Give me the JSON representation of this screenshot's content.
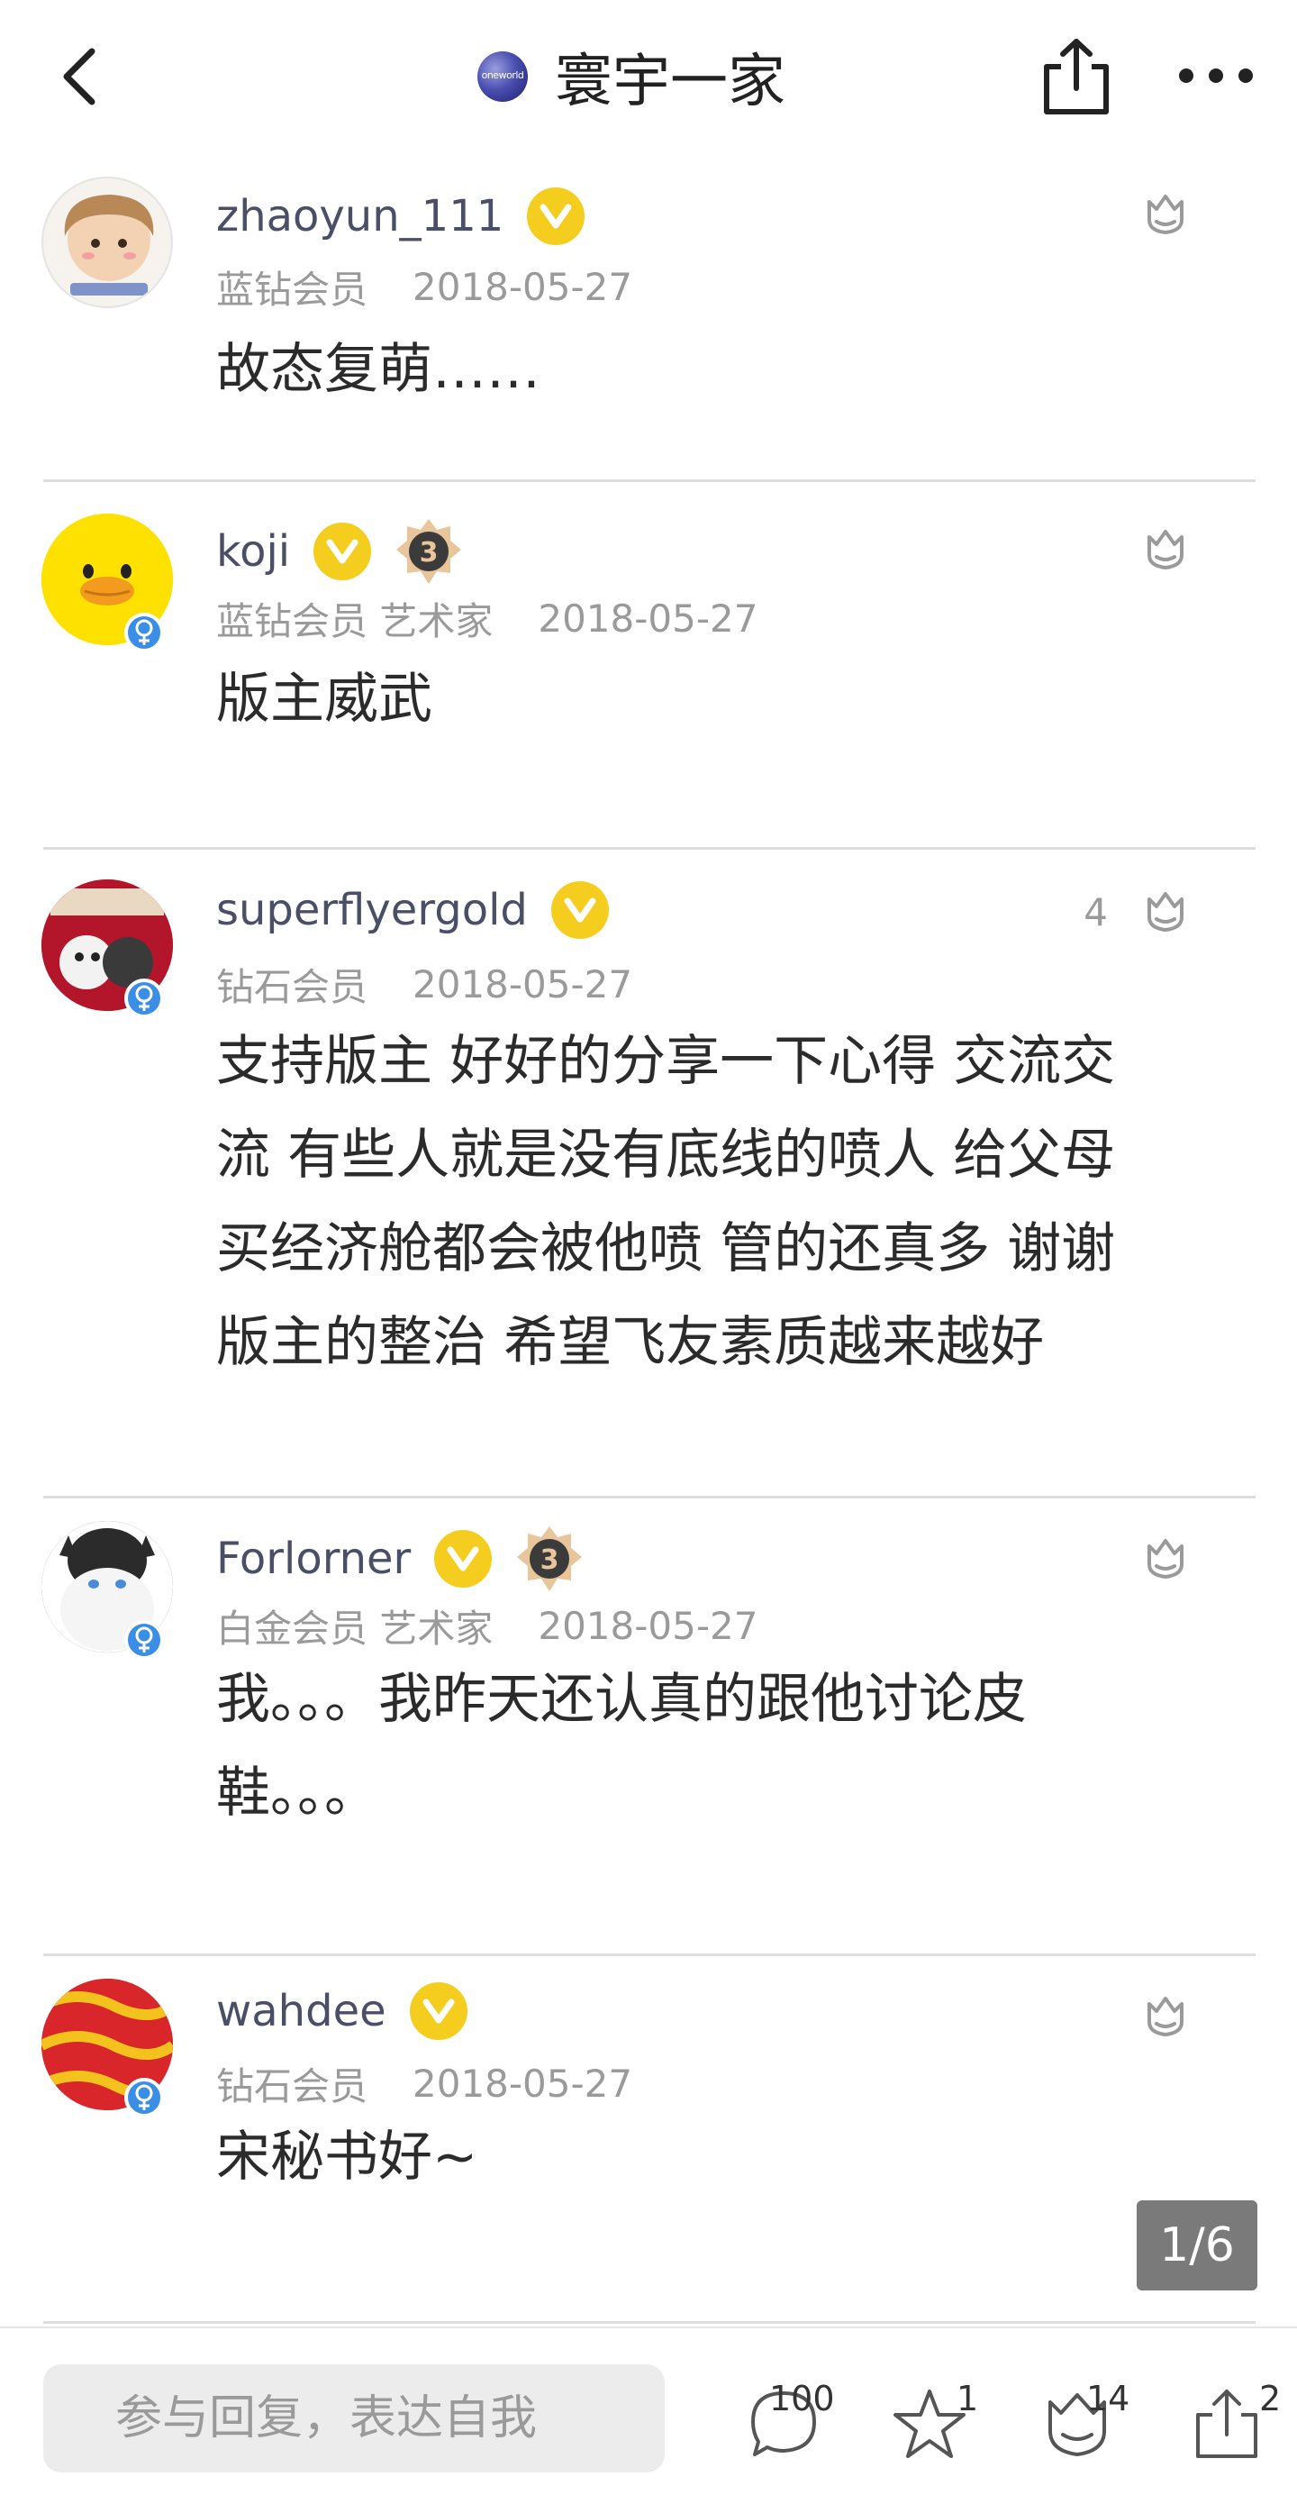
{
  "header": {
    "title": "寰宇一家",
    "logo_text": "oneworld",
    "icons": [
      "back-icon",
      "share-icon",
      "more-icon"
    ]
  },
  "comments": [
    {
      "username": "zhaoyun_111",
      "member": "蓝钻会员",
      "date": "2018-05-27",
      "content_lines": [
        "故态复萌……"
      ],
      "likes": "",
      "verified": true,
      "level": "",
      "gender": ""
    },
    {
      "username": "koji",
      "member": "蓝钻会员 艺术家",
      "date": "2018-05-27",
      "content_lines": [
        "版主威武"
      ],
      "likes": "",
      "verified": true,
      "level": "3",
      "gender": "female"
    },
    {
      "username": "superflyergold",
      "member": "钻石会员",
      "date": "2018-05-27",
      "content_lines": [
        "支持版主 好好的分享一下心得 交流交",
        "流 有些人就是没有底线的喷人 给父母",
        "买经济舱都会被他喷 管的还真多 谢谢",
        "版主的整治 希望飞友素质越来越好"
      ],
      "likes": "4",
      "verified": true,
      "level": "",
      "gender": "female"
    },
    {
      "username": "Forlorner",
      "member": "白金会员 艺术家",
      "date": "2018-05-27",
      "content_lines": [
        "我。。。我昨天还认真的跟他讨论皮",
        "鞋。。。"
      ],
      "likes": "",
      "verified": true,
      "level": "3",
      "gender": "female"
    },
    {
      "username": "wahdee",
      "member": "钻石会员",
      "date": "2018-05-27",
      "content_lines": [
        "宋秘书好~"
      ],
      "likes": "",
      "verified": true,
      "level": "",
      "gender": "female"
    }
  ],
  "page_indicator": "1/6",
  "bottom_bar": {
    "reply_placeholder": "参与回复，表达自我",
    "comments_count": "100",
    "favorites_count": "1",
    "likes_count": "14",
    "shares_count": "2"
  },
  "colors": {
    "verified_badge": "#f5cd1e",
    "gender_badge": "#3a8ee6",
    "text_primary": "#2b2b2b",
    "text_secondary": "#9a9a9a",
    "divider": "#dddddd"
  }
}
